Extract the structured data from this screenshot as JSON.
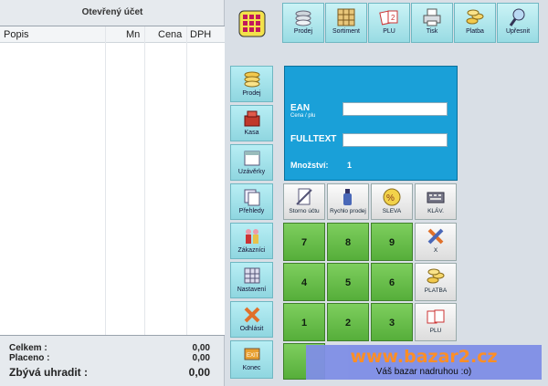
{
  "receipt": {
    "title": "Otevřený účet",
    "columns": [
      "Popis",
      "Mn",
      "Cena",
      "DPH"
    ],
    "celkem_label": "Celkem :",
    "celkem_value": "0,00",
    "placeno_label": "Placeno :",
    "placeno_value": "0,00",
    "zbyva_label": "Zbývá uhradit :",
    "zbyva_value": "0,00"
  },
  "toolbar": [
    {
      "label": "Prodej",
      "icon": "coins-icon"
    },
    {
      "label": "Sortiment",
      "icon": "shelves-icon"
    },
    {
      "label": "PLU",
      "icon": "plu-cards-icon"
    },
    {
      "label": "Tisk",
      "icon": "printer-icon"
    },
    {
      "label": "Platba",
      "icon": "coins-stack-icon"
    },
    {
      "label": "Upřesnit",
      "icon": "magnifier-icon"
    }
  ],
  "nav": [
    {
      "label": "Prodej",
      "icon": "coins-icon"
    },
    {
      "label": "Kasa",
      "icon": "register-icon"
    },
    {
      "label": "Uzávěrky",
      "icon": "calendar-icon"
    },
    {
      "label": "Přehledy",
      "icon": "documents-icon"
    },
    {
      "label": "Zákazníci",
      "icon": "customers-icon"
    },
    {
      "label": "Nastavení",
      "icon": "settings-grid-icon"
    },
    {
      "label": "Odhlásit",
      "icon": "x-icon"
    },
    {
      "label": "Konec",
      "icon": "exit-icon"
    }
  ],
  "input": {
    "ean_label": "EAN",
    "ean_sub": "Cena / plu",
    "ean_value": "",
    "fulltext_label": "FULLTEXT",
    "fulltext_value": "",
    "mnozstvi_label": "Množství:",
    "mnozstvi_value": "1"
  },
  "fkeys": [
    {
      "label": "Storno účtu",
      "icon": "storno-icon"
    },
    {
      "label": "Rychlo prodej",
      "icon": "bottle-icon"
    },
    {
      "label": "SLEVA",
      "icon": "percent-icon"
    },
    {
      "label": "KLÁV.",
      "icon": "keyboard-icon"
    }
  ],
  "keys": [
    "7",
    "8",
    "9",
    "4",
    "5",
    "6",
    "1",
    "2",
    "3"
  ],
  "side_keys": [
    {
      "label": "X",
      "icon": "x-icon"
    },
    {
      "label": "PLATBA",
      "icon": "coins-stack-icon"
    },
    {
      "label": "PLU",
      "icon": "plu-cards-icon"
    }
  ],
  "watermark": {
    "title": "www.bazar2.cz",
    "subtitle": "Váš bazar nadruhou    :o)"
  },
  "colors": {
    "panel_blue": "#1aa0d8",
    "key_green": "#6cc04a",
    "nav_cyan": "#a6e4ec"
  }
}
